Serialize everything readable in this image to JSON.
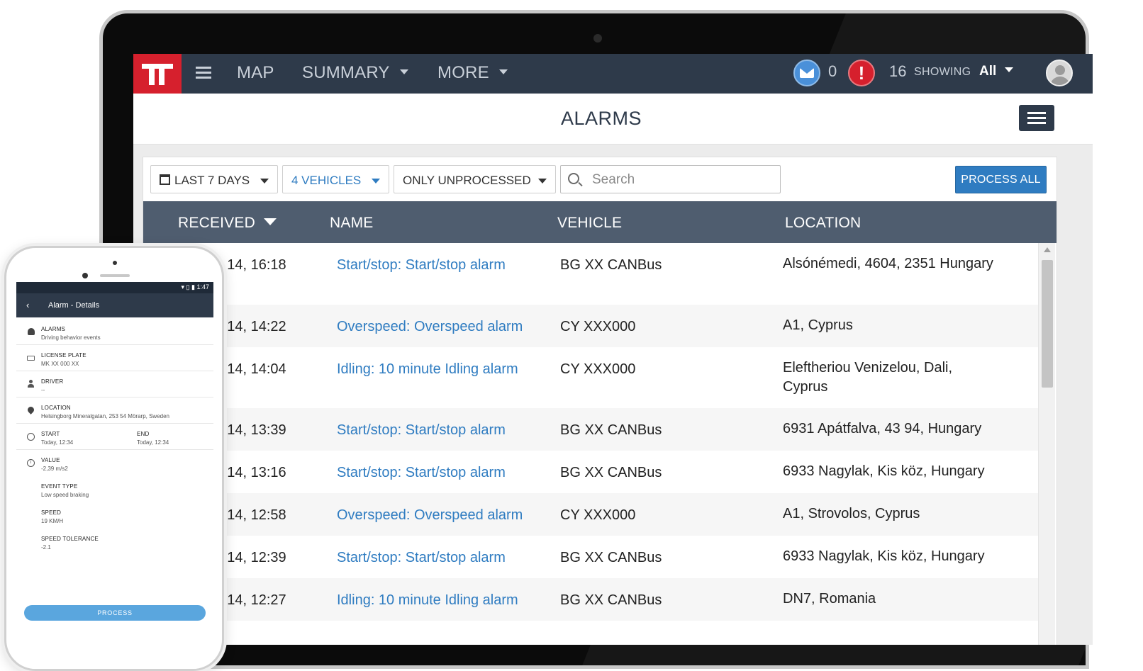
{
  "nav": {
    "map": "MAP",
    "summary": "SUMMARY",
    "more": "MORE",
    "messages_count": "0",
    "alerts_count": "16",
    "alert_symbol": "!",
    "showing_label": "SHOWING",
    "showing_value": "All"
  },
  "page": {
    "title": "ALARMS"
  },
  "filters": {
    "range": "LAST 7 DAYS",
    "vehicles": "4 VEHICLES",
    "status": "ONLY UNPROCESSED",
    "search_placeholder": "Search",
    "process_all": "PROCESS ALL"
  },
  "table": {
    "headers": {
      "received": "RECEIVED",
      "name": "NAME",
      "vehicle": "VEHICLE",
      "location": "LOCATION"
    },
    "rows": [
      {
        "received": "ry 14, 16:18",
        "name": "Start/stop: Start/stop alarm",
        "vehicle": "BG XX CANBus",
        "location": "Alsónémedi, 4604, 2351 Hungary"
      },
      {
        "received": "ry 14, 14:22",
        "name": "Overspeed: Overspeed alarm",
        "vehicle": "CY XXX000",
        "location": "A1, Cyprus"
      },
      {
        "received": "ry 14, 14:04",
        "name": "Idling: 10 minute Idling alarm",
        "vehicle": "CY XXX000",
        "location": "Eleftheriou Venizelou, Dali, Cyprus"
      },
      {
        "received": "ry 14, 13:39",
        "name": "Start/stop: Start/stop alarm",
        "vehicle": "BG XX CANBus",
        "location": "6931 Apátfalva, 43 94, Hungary"
      },
      {
        "received": "ry 14, 13:16",
        "name": "Start/stop: Start/stop alarm",
        "vehicle": "BG XX CANBus",
        "location": "6933 Nagylak, Kis köz, Hungary"
      },
      {
        "received": "ry 14, 12:58",
        "name": "Overspeed: Overspeed alarm",
        "vehicle": "CY XXX000",
        "location": "A1, Strovolos, Cyprus"
      },
      {
        "received": "ry 14, 12:39",
        "name": "Start/stop: Start/stop alarm",
        "vehicle": "BG XX CANBus",
        "location": "6933 Nagylak, Kis köz, Hungary"
      },
      {
        "received": "ry 14, 12:27",
        "name": "Idling: 10 minute Idling alarm",
        "vehicle": "BG XX CANBus",
        "location": "DN7, Romania"
      }
    ]
  },
  "phone": {
    "time": "1:47",
    "title": "Alarm - Details",
    "back_symbol": "‹",
    "alarms_label": "ALARMS",
    "alarms_value": "Driving behavior events",
    "plate_label": "LICENSE PLATE",
    "plate_value": "MK XX 000 XX",
    "driver_label": "DRIVER",
    "driver_value": "--",
    "location_label": "LOCATION",
    "location_value": "Helsingborg Mineralgatan, 253 54 Mörarp, Sweden",
    "start_label": "START",
    "start_value": "Today, 12:34",
    "end_label": "END",
    "end_value": "Today, 12:34",
    "value_label": "VALUE",
    "value_value": "-2,39 m/s2",
    "event_type_label": "EVENT TYPE",
    "event_type_value": "Low speed braking",
    "speed_label": "SPEED",
    "speed_value": "19 KM/H",
    "tolerance_label": "SPEED TOLERANCE",
    "tolerance_value": "-2.1",
    "process": "PROCESS"
  },
  "colors": {
    "topbar": "#2e3a4a",
    "brand": "#d6202d",
    "accent": "#2f7cc1",
    "table_header": "#4f5d6f"
  }
}
